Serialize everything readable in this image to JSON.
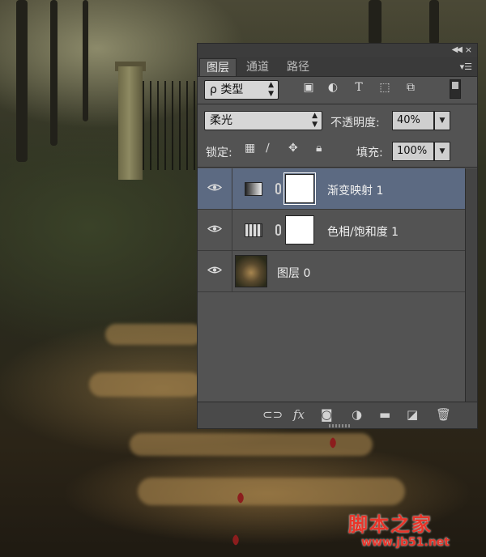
{
  "panel": {
    "tabs": [
      {
        "label": "图层",
        "active": true
      },
      {
        "label": "通道",
        "active": false
      },
      {
        "label": "路径",
        "active": false
      }
    ],
    "filter": {
      "label": "ρ 类型"
    },
    "blend_mode": "柔光",
    "opacity": {
      "label": "不透明度:",
      "value": "40%"
    },
    "lock": {
      "label": "锁定:"
    },
    "fill": {
      "label": "填充:",
      "value": "100%"
    },
    "layers": [
      {
        "name": "渐变映射 1",
        "type": "gradient-map",
        "selected": true
      },
      {
        "name": "色相/饱和度 1",
        "type": "hue-saturation",
        "selected": false
      },
      {
        "name": "图层 0",
        "type": "pixel",
        "selected": false
      }
    ]
  },
  "watermark": {
    "text": "脚本之家",
    "url": "www.jb51.net"
  },
  "colors": {
    "panel_bg": "#535353",
    "selected_layer": "#5c6a82",
    "watermark": "#e8352a"
  }
}
